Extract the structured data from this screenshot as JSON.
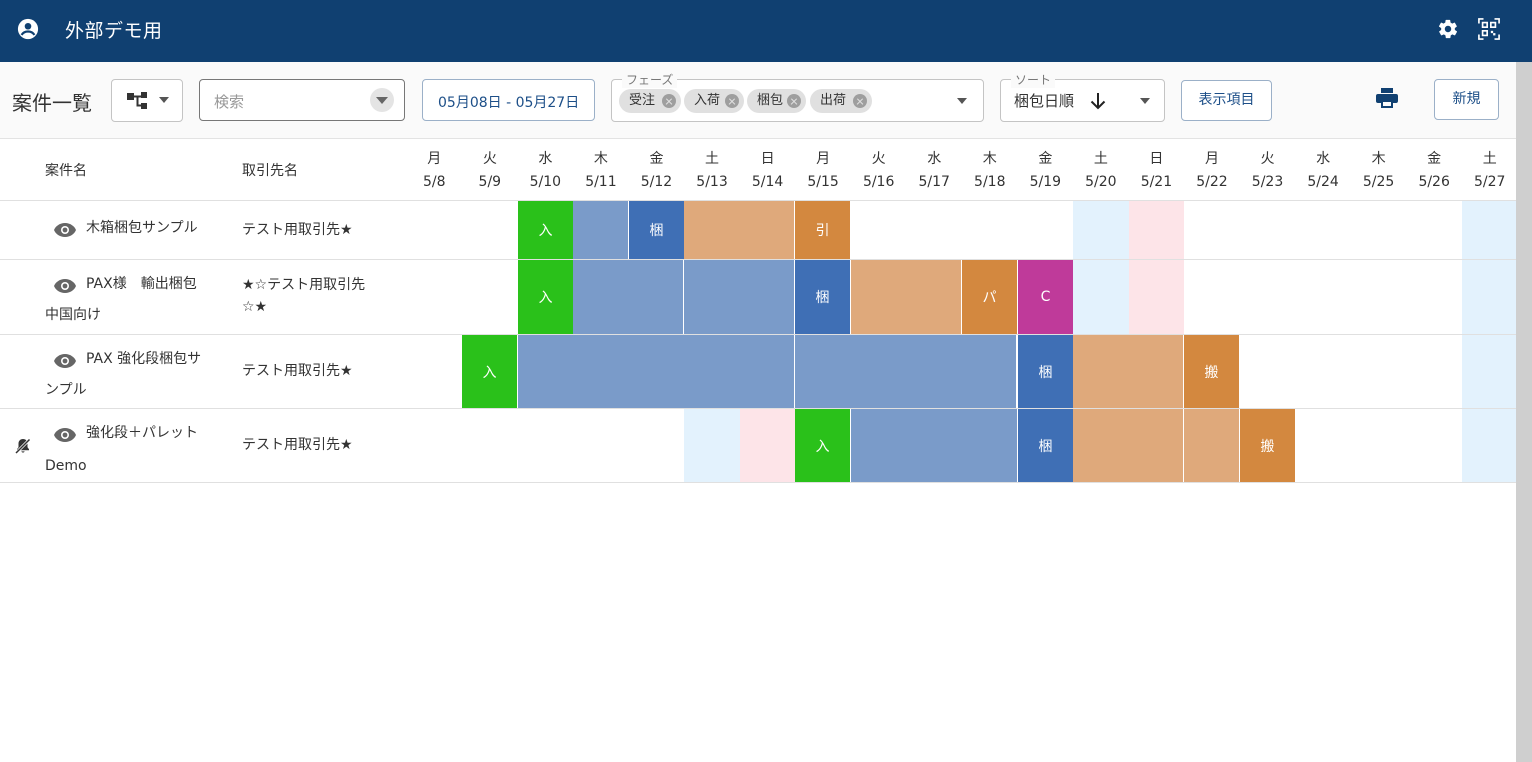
{
  "app": {
    "title": "外部デモ用"
  },
  "toolbar": {
    "title": "案件一覧",
    "search_placeholder": "検索",
    "date_range": "05月08日 - 05月27日",
    "phase_label": "フェーズ",
    "phase_chips": [
      "受注",
      "入荷",
      "梱包",
      "出荷"
    ],
    "sort_label": "ソート",
    "sort_value": "梱包日順",
    "display_items_label": "表示項目",
    "new_label": "新規"
  },
  "grid": {
    "name_header": "案件名",
    "client_header": "取引先名",
    "days": [
      {
        "dow": "月",
        "date": "5/8"
      },
      {
        "dow": "火",
        "date": "5/9"
      },
      {
        "dow": "水",
        "date": "5/10"
      },
      {
        "dow": "木",
        "date": "5/11"
      },
      {
        "dow": "金",
        "date": "5/12"
      },
      {
        "dow": "土",
        "date": "5/13"
      },
      {
        "dow": "日",
        "date": "5/14"
      },
      {
        "dow": "月",
        "date": "5/15"
      },
      {
        "dow": "火",
        "date": "5/16"
      },
      {
        "dow": "水",
        "date": "5/17"
      },
      {
        "dow": "木",
        "date": "5/18"
      },
      {
        "dow": "金",
        "date": "5/19"
      },
      {
        "dow": "土",
        "date": "5/20"
      },
      {
        "dow": "日",
        "date": "5/21"
      },
      {
        "dow": "月",
        "date": "5/22"
      },
      {
        "dow": "火",
        "date": "5/23"
      },
      {
        "dow": "水",
        "date": "5/24"
      },
      {
        "dow": "木",
        "date": "5/25"
      },
      {
        "dow": "金",
        "date": "5/26"
      },
      {
        "dow": "土",
        "date": "5/27"
      }
    ],
    "rows": [
      {
        "name_line1": "木箱梱包サンプル",
        "name_line2": "",
        "client_line1": "テスト用取引先★",
        "client_line2": "",
        "bell": false,
        "bars": [
          {
            "from": 2,
            "to": 2,
            "label": "入",
            "color": "#2ac11a"
          },
          {
            "from": 3,
            "to": 3,
            "label": "",
            "color": "#7a9bc9"
          },
          {
            "from": 4,
            "to": 4,
            "label": "梱",
            "color": "#3f6fb5"
          },
          {
            "from": 5,
            "to": 6,
            "label": "",
            "color": "#dfa97b"
          },
          {
            "from": 7,
            "to": 7,
            "label": "引",
            "color": "#d3883f"
          }
        ]
      },
      {
        "name_line1": "PAX様　輸出梱包",
        "name_line2": "中国向け",
        "client_line1": "★☆テスト用取引先",
        "client_line2": "☆★",
        "bell": false,
        "bars": [
          {
            "from": 2,
            "to": 2,
            "label": "入",
            "color": "#2ac11a"
          },
          {
            "from": 3,
            "to": 4,
            "label": "",
            "color": "#7a9bc9"
          },
          {
            "from": 5,
            "to": 6,
            "label": "",
            "color": "#7a9bc9"
          },
          {
            "from": 7,
            "to": 7,
            "label": "梱",
            "color": "#3f6fb5"
          },
          {
            "from": 8,
            "to": 9,
            "label": "",
            "color": "#dfa97b"
          },
          {
            "from": 10,
            "to": 10,
            "label": "パ",
            "color": "#d3883f"
          },
          {
            "from": 11,
            "to": 11,
            "label": "C",
            "color": "#bf3a9a"
          }
        ]
      },
      {
        "name_line1": "PAX 強化段梱包サ",
        "name_line2": "ンプル",
        "client_line1": "テスト用取引先★",
        "client_line2": "",
        "bell": false,
        "bars": [
          {
            "from": 1,
            "to": 1,
            "label": "入",
            "color": "#2ac11a"
          },
          {
            "from": 2,
            "to": 4,
            "label": "",
            "color": "#7a9bc9"
          },
          {
            "from": 5,
            "to": 6,
            "label": "",
            "color": "#7a9bc9"
          },
          {
            "from": 7,
            "to": 10,
            "label": "",
            "color": "#7a9bc9"
          },
          {
            "from": 11,
            "to": 11,
            "label": "梱",
            "color": "#3f6fb5"
          },
          {
            "from": 12,
            "to": 13,
            "label": "",
            "color": "#dfa97b"
          },
          {
            "from": 14,
            "to": 14,
            "label": "搬",
            "color": "#d3883f"
          }
        ]
      },
      {
        "name_line1": "強化段＋パレット",
        "name_line2": "Demo",
        "client_line1": "テスト用取引先★",
        "client_line2": "",
        "bell": true,
        "bars": [
          {
            "from": 7,
            "to": 7,
            "label": "入",
            "color": "#2ac11a"
          },
          {
            "from": 8,
            "to": 10,
            "label": "",
            "color": "#7a9bc9"
          },
          {
            "from": 11,
            "to": 11,
            "label": "梱",
            "color": "#3f6fb5"
          },
          {
            "from": 12,
            "to": 13,
            "label": "",
            "color": "#dfa97b"
          },
          {
            "from": 14,
            "to": 14,
            "label": "",
            "color": "#dfa97b"
          },
          {
            "from": 15,
            "to": 15,
            "label": "搬",
            "color": "#d3883f"
          }
        ]
      }
    ],
    "weekend_colors": {
      "sat": "#e3f2fd",
      "sun": "#fde4e8"
    }
  }
}
